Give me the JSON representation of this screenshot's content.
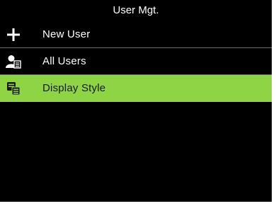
{
  "title": "User Mgt.",
  "menu": [
    {
      "label": "New User",
      "icon": "plus-icon",
      "selected": false
    },
    {
      "label": "All Users",
      "icon": "user-list-icon",
      "selected": false
    },
    {
      "label": "Display Style",
      "icon": "display-style-icon",
      "selected": true
    }
  ],
  "colors": {
    "background": "#000000",
    "selected_highlight": "#8fd444",
    "divider": "#6e6e6e",
    "text": "#ffffff"
  }
}
